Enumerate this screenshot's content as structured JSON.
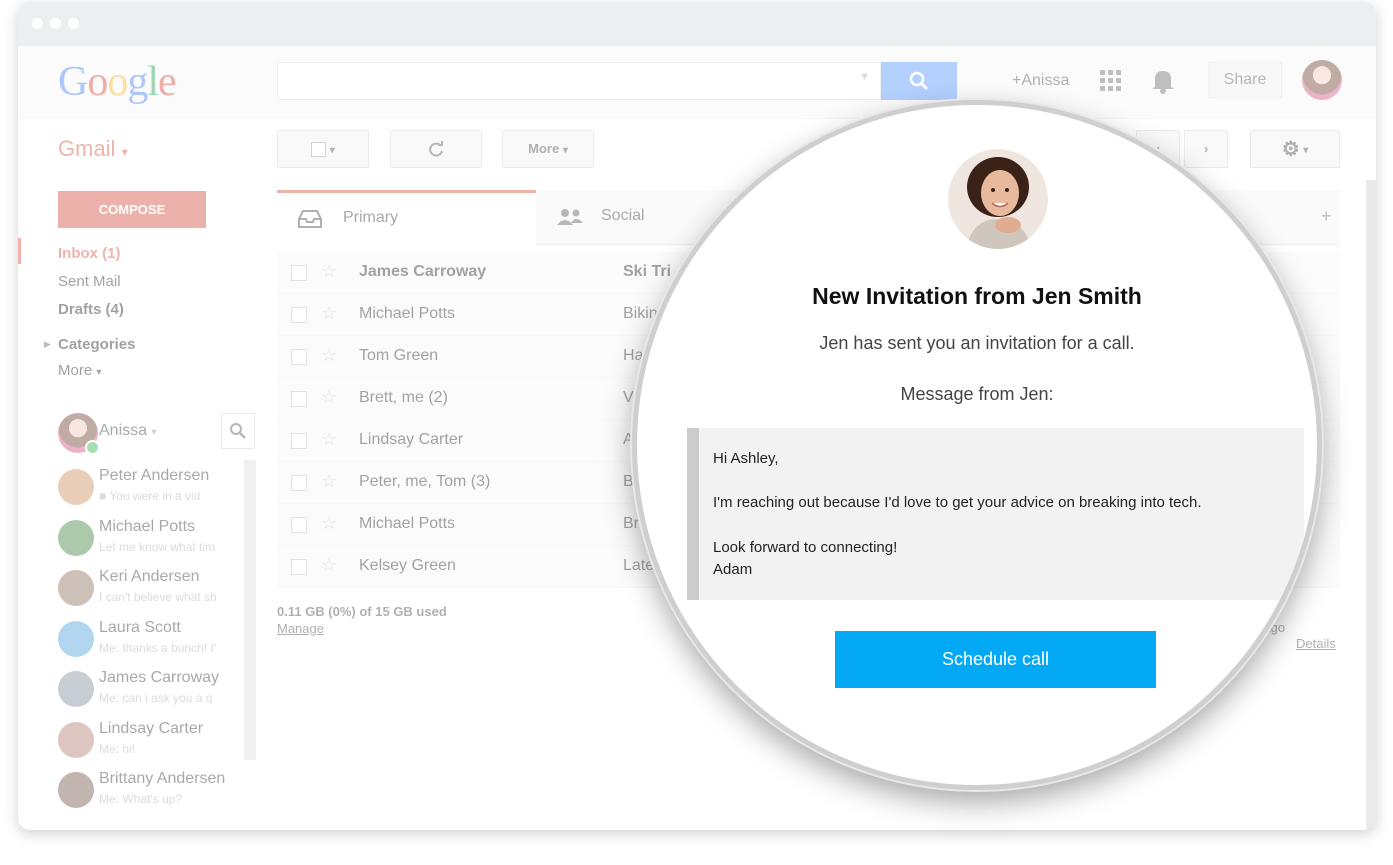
{
  "top": {
    "user": "+Anissa",
    "share": "Share"
  },
  "sidebar": {
    "app_name": "Gmail",
    "compose": "COMPOSE",
    "nav": [
      "Inbox (1)",
      "Sent Mail",
      "Drafts (4)",
      "Categories",
      "More"
    ],
    "chat_user": "Anissa",
    "contacts": [
      {
        "name": "Peter Andersen",
        "sub": "You were in a vid"
      },
      {
        "name": "Michael Potts",
        "sub": "Let me know what tim"
      },
      {
        "name": "Keri Andersen",
        "sub": "I can't believe what sh"
      },
      {
        "name": "Laura Scott",
        "sub": "Me: thanks a bunch! I'"
      },
      {
        "name": "James Carroway",
        "sub": "Me: can i ask you a q"
      },
      {
        "name": "Lindsay Carter",
        "sub": "Me: hi!"
      },
      {
        "name": "Brittany Andersen",
        "sub": "Me: What's up?"
      }
    ]
  },
  "toolbar": {
    "more": "More"
  },
  "tabs": {
    "primary": "Primary",
    "social": "Social"
  },
  "emails": [
    {
      "sender": "James Carroway",
      "subject": "Ski Tri"
    },
    {
      "sender": "Michael Potts",
      "subject": "Bikin"
    },
    {
      "sender": "Tom Green",
      "subject": "Ha"
    },
    {
      "sender": "Brett, me (2)",
      "subject": "V"
    },
    {
      "sender": "Lindsay Carter",
      "subject": "A"
    },
    {
      "sender": "Peter, me, Tom (3)",
      "subject": "B"
    },
    {
      "sender": "Michael Potts",
      "subject": "Br"
    },
    {
      "sender": "Kelsey Green",
      "subject": "Late"
    }
  ],
  "footer": {
    "storage": "0.11 GB (0%) of 15 GB used",
    "manage": "Manage",
    "activity": "nutes ago",
    "details": "Details"
  },
  "invitation": {
    "title": "New Invitation from Jen Smith",
    "subtitle": "Jen has sent you an invitation for a call.",
    "message_from": "Message from Jen:",
    "message": {
      "greeting": "Hi Ashley,",
      "body": "I'm reaching out because I'd love to get your advice on breaking into tech.",
      "closing": "Look forward to connecting!",
      "signature": "Adam"
    },
    "button": "Schedule call"
  },
  "colors": {
    "accent_red": "#dd4b39",
    "search_blue": "#4d90fe",
    "button_blue": "#03a9f4"
  }
}
